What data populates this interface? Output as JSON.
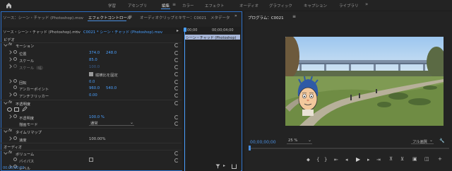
{
  "workspace_tabs": [
    {
      "label": "学習",
      "active": false
    },
    {
      "label": "アセンブリ",
      "active": false
    },
    {
      "label": "編集",
      "active": true
    },
    {
      "label": "カラー",
      "active": false
    },
    {
      "label": "エフェクト",
      "active": false
    },
    {
      "label": "オーディオ",
      "active": false
    },
    {
      "label": "グラフィック",
      "active": false
    },
    {
      "label": "キャプション",
      "active": false
    },
    {
      "label": "ライブラリ",
      "active": false
    }
  ],
  "ec_tabs": {
    "source": "ソース：シーン・チャッド (Photoshop).mov",
    "effect_controls": "エフェクトコントロール",
    "audio_mixer": "オーディオクリップミキサー：C0021",
    "metadata": "メタデータ"
  },
  "ec_subheader": {
    "source_clip": "ソース・シーン・チャッド (Photoshop).mov",
    "target_clip": "C0021 * シーン・チャッド (Photoshop).mov"
  },
  "timeline_mini": {
    "tc_start": "00;00",
    "tc_mid": "00;00;04;00",
    "clip_label": "シーン・チャッド (Photoshop)"
  },
  "sections": {
    "video": "ビデオ",
    "motion": "モーション",
    "opacity": "不透明度",
    "time_remap": "タイムリマップ",
    "audio": "オーディオ",
    "volume": "ボリューム"
  },
  "motion": {
    "position_label": "位置",
    "position_x": "374.0",
    "position_y": "248.0",
    "scale_label": "スケール",
    "scale_value": "85.0",
    "scale_width_label": "スケール（幅）",
    "scale_width_value": "100.0",
    "uniform_scale_label": "縦横比を固定",
    "rotation_label": "回転",
    "rotation_value": "0.0",
    "anchor_label": "アンカーポイント",
    "anchor_x": "960.0",
    "anchor_y": "540.0",
    "flicker_label": "アンチフリッカー",
    "flicker_value": "0.00"
  },
  "opacity": {
    "label": "不透明度",
    "value": "100.0 %",
    "blend_label": "描画モード",
    "blend_value": "通常"
  },
  "time_remap": {
    "speed_label": "速度",
    "speed_value": "100.00%"
  },
  "volume": {
    "bypass_label": "バイパス",
    "level_label": "レベル"
  },
  "footer_timecode": "00;00;00;00",
  "program": {
    "title": "プログラム：C0021",
    "timecode": "00;00;00;00",
    "zoom": "25 %",
    "quality": "フル画質"
  },
  "colors": {
    "accent": "#4a8fe0",
    "value_blue": "#4aa0ff",
    "panel_bg": "#232323",
    "program_timecode": "#4a8fe0"
  }
}
